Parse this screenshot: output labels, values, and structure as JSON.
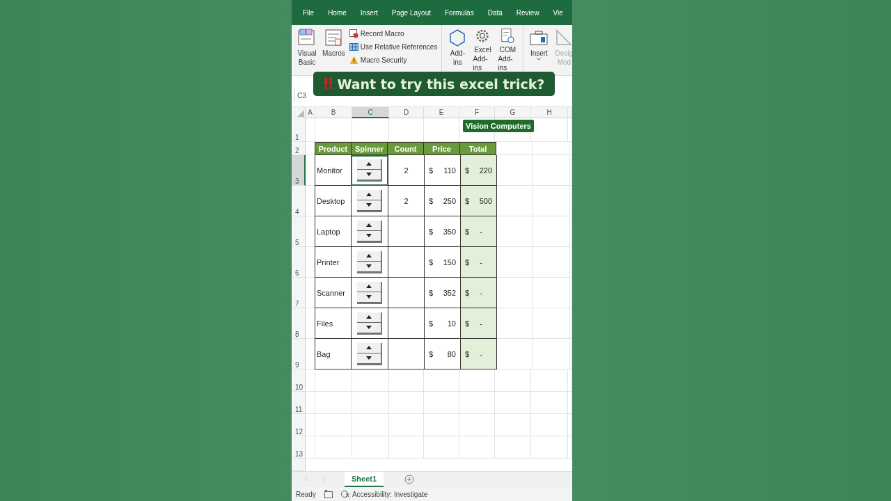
{
  "menu_tabs": [
    {
      "label": "File",
      "selected": false
    },
    {
      "label": "Home",
      "selected": false
    },
    {
      "label": "Insert",
      "selected": false
    },
    {
      "label": "Page Layout",
      "selected": false
    },
    {
      "label": "Formulas",
      "selected": false
    },
    {
      "label": "Data",
      "selected": false
    },
    {
      "label": "Review",
      "selected": false
    },
    {
      "label": "Vie",
      "selected": false
    }
  ],
  "ribbon": {
    "groups": [
      {
        "large": [
          {
            "kind": "vba",
            "lines": [
              "Visual",
              "Basic"
            ],
            "disabled": false
          },
          {
            "kind": "macros",
            "lines": [
              "Macros"
            ],
            "disabled": false
          }
        ],
        "small": [
          {
            "kind": "record",
            "label": "Record Macro"
          },
          {
            "kind": "relative",
            "label": "Use Relative References"
          },
          {
            "kind": "warning",
            "label": "Macro Security"
          }
        ]
      },
      {
        "large": [
          {
            "kind": "addins",
            "lines": [
              "Add-",
              "ins"
            ],
            "disabled": false
          },
          {
            "kind": "gear",
            "lines": [
              "Excel",
              "Add-ins"
            ],
            "disabled": false
          },
          {
            "kind": "com",
            "lines": [
              "COM",
              "Add-ins"
            ],
            "disabled": false
          }
        ]
      },
      {
        "large": [
          {
            "kind": "insert",
            "lines": [
              "Insert"
            ],
            "disabled": false,
            "dropdown": true
          },
          {
            "kind": "design",
            "lines": [
              "Desig",
              "Mod"
            ],
            "disabled": true
          }
        ]
      }
    ]
  },
  "banner": {
    "icon": "‼",
    "text": "Want to try this excel trick?"
  },
  "name_box": "C3",
  "sheet": {
    "columns": [
      {
        "label": "A",
        "selected": false
      },
      {
        "label": "B",
        "selected": false
      },
      {
        "label": "C",
        "selected": true
      },
      {
        "label": "D",
        "selected": false
      },
      {
        "label": "E",
        "selected": false
      },
      {
        "label": "F",
        "selected": false
      },
      {
        "label": "G",
        "selected": false
      },
      {
        "label": "H",
        "selected": false
      }
    ],
    "row_numbers": [
      {
        "label": "1",
        "selected": false
      },
      {
        "label": "2",
        "selected": false
      },
      {
        "label": "3",
        "selected": true
      },
      {
        "label": "4",
        "selected": false
      },
      {
        "label": "5",
        "selected": false
      },
      {
        "label": "6",
        "selected": false
      },
      {
        "label": "7",
        "selected": false
      },
      {
        "label": "8",
        "selected": false
      },
      {
        "label": "9",
        "selected": false
      },
      {
        "label": "10",
        "selected": false
      },
      {
        "label": "11",
        "selected": false
      },
      {
        "label": "12",
        "selected": false
      },
      {
        "label": "13",
        "selected": false
      }
    ],
    "callout": "Vision Computers"
  },
  "table": {
    "headers": [
      "Product",
      "Spinner",
      "Count",
      "Price",
      "Total"
    ],
    "rows": [
      {
        "product": "Monitor",
        "selected": true,
        "count": "2",
        "price_symbol": "$",
        "price": "110",
        "total_symbol": "$",
        "total": "220"
      },
      {
        "product": "Desktop",
        "selected": false,
        "count": "2",
        "price_symbol": "$",
        "price": "250",
        "total_symbol": "$",
        "total": "500"
      },
      {
        "product": "Laptop",
        "selected": false,
        "price_symbol": "$",
        "price": "350",
        "total_symbol": "$",
        "total": "-"
      },
      {
        "product": "Printer",
        "selected": false,
        "price_symbol": "$",
        "price": "150",
        "total_symbol": "$",
        "total": "-"
      },
      {
        "product": "Scanner",
        "selected": false,
        "price_symbol": "$",
        "price": "352",
        "total_symbol": "$",
        "total": "-"
      },
      {
        "product": "Files",
        "selected": false,
        "price_symbol": "$",
        "price": "10",
        "total_symbol": "$",
        "total": "-"
      },
      {
        "product": "Bag",
        "selected": false,
        "price_symbol": "$",
        "price": "80",
        "total_symbol": "$",
        "total": "-"
      }
    ]
  },
  "sheet_tabs": [
    {
      "label": "Sheet1",
      "selected": true
    }
  ],
  "status_bar": {
    "status": "Ready",
    "accessibility": "Accessibility: Investigate"
  }
}
